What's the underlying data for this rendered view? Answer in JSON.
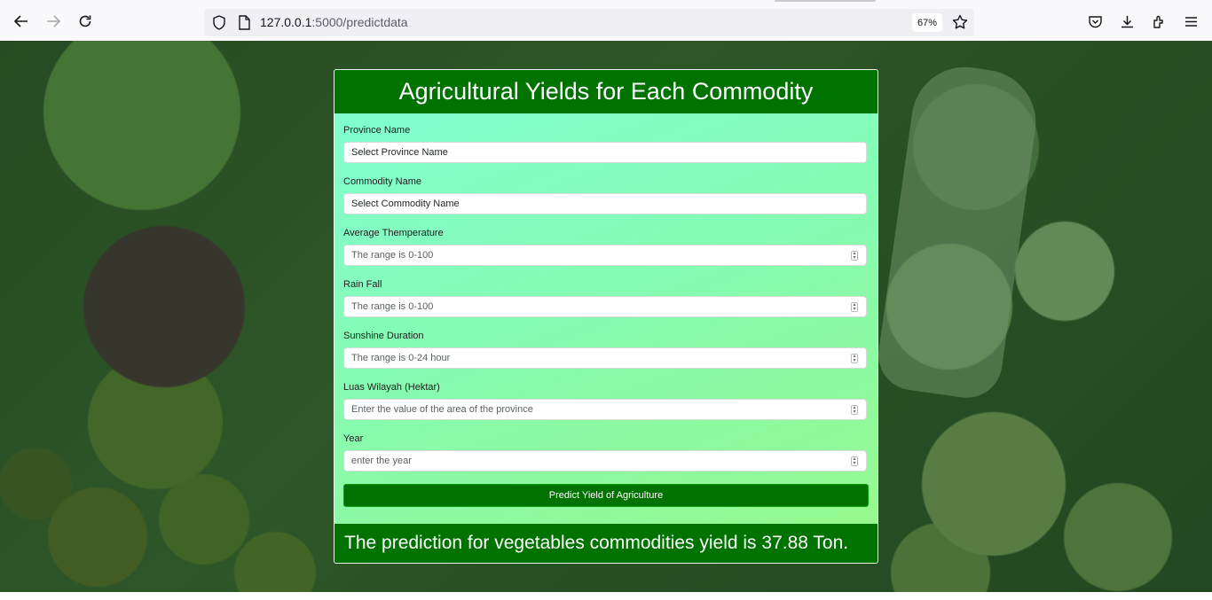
{
  "browser": {
    "url_host": "127.0.0.1",
    "url_path": ":5000/predictdata",
    "zoom": "67%",
    "icons": [
      "back-icon",
      "forward-icon",
      "reload-icon",
      "shield-icon",
      "page-icon",
      "star-icon",
      "pocket-icon",
      "download-icon",
      "extensions-icon",
      "menu-icon"
    ]
  },
  "page": {
    "title": "Agricultural Yields for Each Commodity",
    "fields": [
      {
        "label": "Province Name",
        "type": "select",
        "value": "Select Province Name"
      },
      {
        "label": "Commodity Name",
        "type": "select",
        "value": "Select Commodity Name"
      },
      {
        "label": "Average Themperature",
        "type": "number",
        "placeholder": "The range is 0-100"
      },
      {
        "label": "Rain Fall",
        "type": "number",
        "placeholder": "The range is 0-100"
      },
      {
        "label": "Sunshine Duration",
        "type": "number",
        "placeholder": "The range is 0-24 hour"
      },
      {
        "label": "Luas Wilayah (Hektar)",
        "type": "number",
        "placeholder": "Enter the value of the area of the province"
      },
      {
        "label": "Year",
        "type": "number",
        "placeholder": "enter the year"
      }
    ],
    "button_label": "Predict Yield of Agriculture",
    "result_text": "The prediction for vegetables commodities yield is 37.88 Ton."
  },
  "colors": {
    "header_green": "#007200",
    "card_gradient_start": "#7fffd4",
    "card_gradient_end": "#98f98a"
  }
}
